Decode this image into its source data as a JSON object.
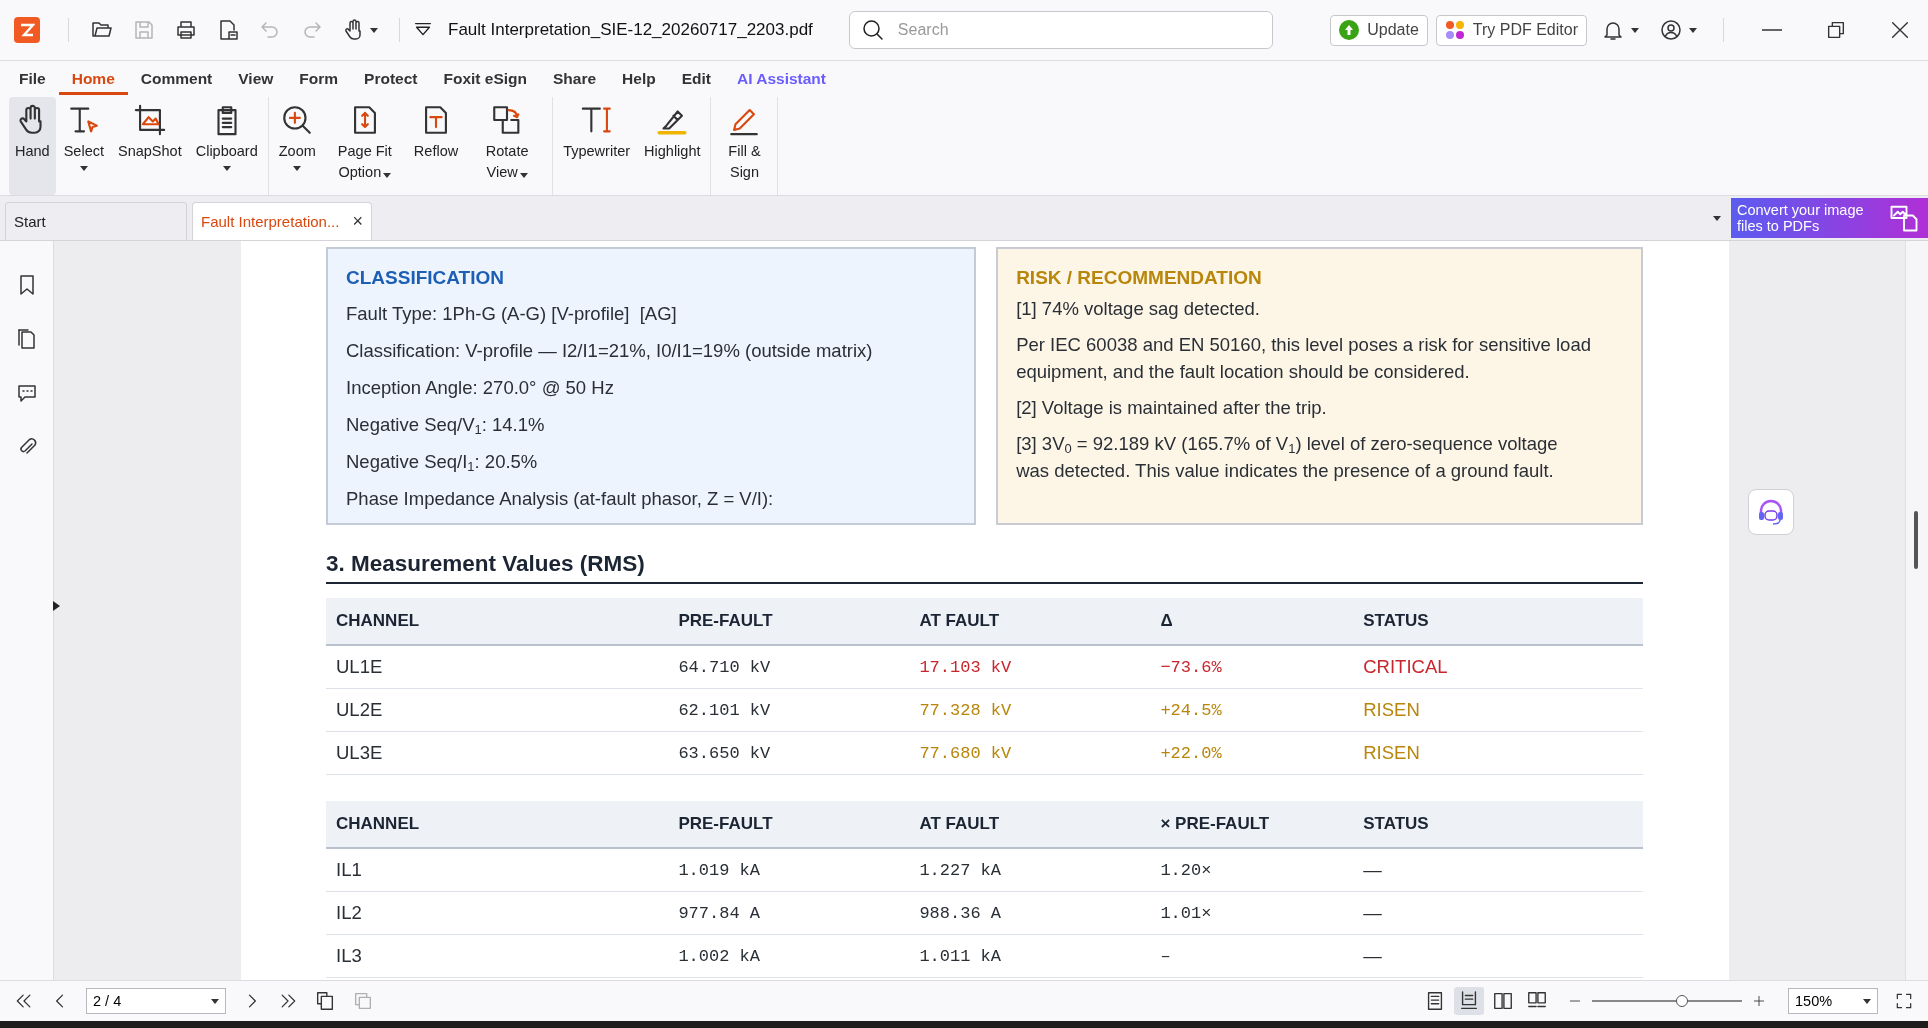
{
  "titlebar": {
    "quick_tools": [
      {
        "kind": "open",
        "disabled": false
      },
      {
        "kind": "save",
        "disabled": true
      },
      {
        "kind": "print",
        "disabled": false
      },
      {
        "kind": "doc",
        "disabled": false
      },
      {
        "kind": "undo",
        "disabled": true
      },
      {
        "kind": "redo",
        "disabled": true
      },
      {
        "kind": "hand",
        "disabled": false
      }
    ],
    "filename": "Fault Interpretation_SIE-12_20260717_2203.pdf",
    "search": {
      "placeholder": "Search"
    },
    "update_button": "Update",
    "editor_button": "Try PDF Editor"
  },
  "menu": [
    {
      "label": "File",
      "selected": false,
      "kind": "plain"
    },
    {
      "label": "Home",
      "selected": true,
      "kind": "plain"
    },
    {
      "label": "Comment",
      "selected": false,
      "kind": "plain"
    },
    {
      "label": "View",
      "selected": false,
      "kind": "plain"
    },
    {
      "label": "Form",
      "selected": false,
      "kind": "plain"
    },
    {
      "label": "Protect",
      "selected": false,
      "kind": "plain"
    },
    {
      "label": "Foxit eSign",
      "selected": false,
      "kind": "plain"
    },
    {
      "label": "Share",
      "selected": false,
      "kind": "plain"
    },
    {
      "label": "Help",
      "selected": false,
      "kind": "plain"
    },
    {
      "label": "Edit",
      "selected": false,
      "kind": "plain"
    },
    {
      "label": "AI Assistant",
      "selected": false,
      "kind": "ai"
    }
  ],
  "ribbon": [
    [
      {
        "label": "Hand",
        "kind": "hand",
        "dropdown": false,
        "selected": true
      },
      {
        "label": "Select",
        "kind": "select",
        "dropdown": true,
        "selected": false
      },
      {
        "label": "SnapShot",
        "kind": "snapshot",
        "dropdown": false,
        "selected": false
      },
      {
        "label": "Clipboard",
        "kind": "clipboard",
        "dropdown": true,
        "selected": false
      }
    ],
    [
      {
        "label": "Zoom",
        "kind": "zoom",
        "dropdown": true,
        "selected": false
      },
      {
        "label": "Page Fit Option",
        "kind": "pagefit",
        "dropdown": true,
        "selected": false
      },
      {
        "label": "Reflow",
        "kind": "reflow",
        "dropdown": false,
        "selected": false
      },
      {
        "label": "Rotate View",
        "kind": "rotate",
        "dropdown": true,
        "selected": false
      }
    ],
    [
      {
        "label": "Typewriter",
        "kind": "typewriter",
        "dropdown": false,
        "selected": false
      },
      {
        "label": "Highlight",
        "kind": "highlight",
        "dropdown": false,
        "selected": false
      }
    ],
    [
      {
        "label": "Fill & Sign",
        "kind": "fillsign",
        "dropdown": false,
        "selected": false
      }
    ]
  ],
  "doc_tabs": [
    {
      "label": "Start",
      "selected": false
    },
    {
      "label": "Fault Interpretation...",
      "selected": true,
      "close": "×"
    }
  ],
  "banner": "Convert your image files to PDFs",
  "page": {
    "classification": {
      "title": "CLASSIFICATION",
      "lines": [
        "Fault Type: 1Ph-G (A-G) [V-profile]  [AG]",
        "Classification: V-profile — I2/I1=21%, I0/I1=19% (outside matrix)",
        "Inception Angle: 270.0° @ 50 Hz",
        "Negative Seq/V$_{1}$: 14.1%",
        "Negative Seq/I$_{1}$: 20.5%",
        "Phase Impedance Analysis (at-fault phasor, Z = V/I):"
      ]
    },
    "risk": {
      "title": "RISK / RECOMMENDATION",
      "lines": [
        "[1] 74% voltage sag detected.",
        "Per IEC 60038 and EN 50160, this level poses a risk for sensitive load equipment, and the fault location should be considered.",
        "[2] Voltage is maintained after the trip.",
        "[3] 3V$_{0}$ = 92.189 kV (165.7% of V$_{1}$) level of zero-sequence voltage was detected. This value indicates the presence of a ground fault."
      ]
    },
    "section_title": "3. Measurement Values (RMS)",
    "tables": [
      {
        "columns": [
          "CHANNEL",
          "PRE-FAULT",
          "AT FAULT",
          "Δ",
          "STATUS"
        ],
        "rows": [
          {
            "cells": [
              "UL1E",
              "64.710 kV",
              "17.103 kV",
              "−73.6%",
              "CRITICAL"
            ],
            "kind": "critical"
          },
          {
            "cells": [
              "UL2E",
              "62.101 kV",
              "77.328 kV",
              "+24.5%",
              "RISEN"
            ],
            "kind": "risen"
          },
          {
            "cells": [
              "UL3E",
              "63.650 kV",
              "77.680 kV",
              "+22.0%",
              "RISEN"
            ],
            "kind": "risen"
          }
        ]
      },
      {
        "columns": [
          "CHANNEL",
          "PRE-FAULT",
          "AT FAULT",
          "× PRE-FAULT",
          "STATUS"
        ],
        "rows": [
          {
            "cells": [
              "IL1",
              "1.019 kA",
              "1.227 kA",
              "1.20×",
              "—"
            ],
            "kind": "normal"
          },
          {
            "cells": [
              "IL2",
              "977.84 A",
              "988.36 A",
              "1.01×",
              "—"
            ],
            "kind": "normal"
          },
          {
            "cells": [
              "IL3",
              "1.002 kA",
              "1.011 kA",
              "–",
              "—"
            ],
            "kind": "normal"
          }
        ]
      }
    ]
  },
  "bottom": {
    "page_field": "2 / 4",
    "zoom": {
      "level": 0.6
    },
    "zoom_field": "150%",
    "view_modes": [
      {
        "selected": false
      },
      {
        "selected": true
      },
      {
        "selected": false
      },
      {
        "selected": false
      }
    ]
  }
}
